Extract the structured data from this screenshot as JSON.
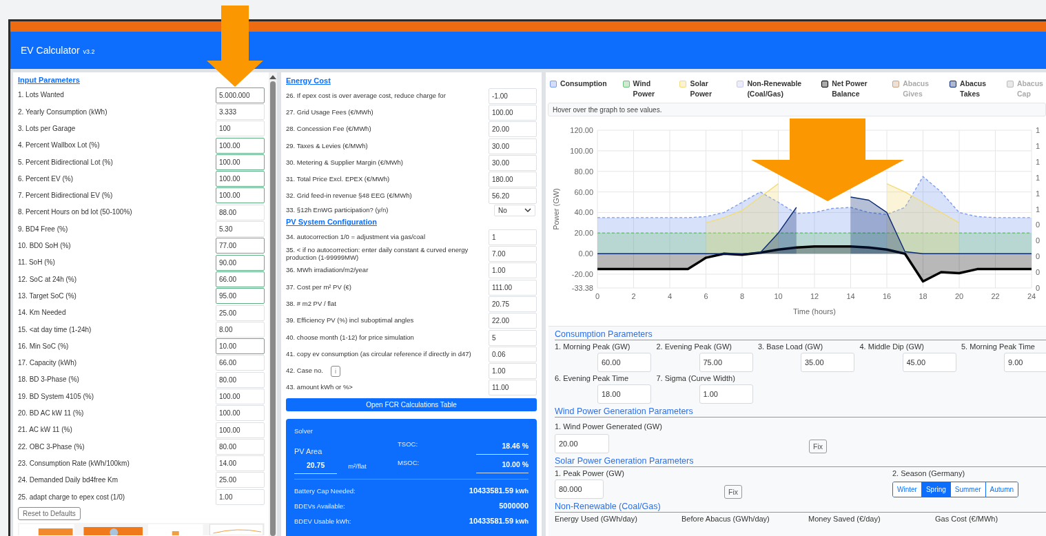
{
  "header": {
    "title": "EV Calculator",
    "version": "v3.2"
  },
  "input_parameters": {
    "title": "Input Parameters",
    "rows": [
      {
        "label": "1. Lots Wanted",
        "value": "5.000.000",
        "highlighted": true
      },
      {
        "label": "2. Yearly Consumption (kWh)",
        "value": "3.333",
        "highlighted": false
      },
      {
        "label": "3. Lots per Garage",
        "value": "100",
        "highlighted": false
      },
      {
        "label": "4. Percent Wallbox Lot (%)",
        "value": "100.00",
        "highlighted": true
      },
      {
        "label": "5. Percent Bidirectional Lot (%)",
        "value": "100.00",
        "highlighted": true
      },
      {
        "label": "6. Percent EV (%)",
        "value": "100.00",
        "highlighted": true
      },
      {
        "label": "7. Percent Bidirectional EV (%)",
        "value": "100.00",
        "highlighted": true
      },
      {
        "label": "8. Percent Hours on bd lot (50-100%)",
        "value": "88.00",
        "highlighted": false
      },
      {
        "label": "9. BD4 Free (%)",
        "value": "5.30",
        "highlighted": false
      },
      {
        "label": "10. BD0 SoH (%)",
        "value": "77.00",
        "highlighted": true
      },
      {
        "label": "11. SoH (%)",
        "value": "90.00",
        "highlighted": true
      },
      {
        "label": "12. SoC at 24h (%)",
        "value": "66.00",
        "highlighted": true
      },
      {
        "label": "13. Target SoC (%)",
        "value": "95.00",
        "highlighted": true
      },
      {
        "label": "14. Km Needed",
        "value": "25.00",
        "highlighted": false
      },
      {
        "label": "15. <at day time (1-24h)",
        "value": "8.00",
        "highlighted": false
      },
      {
        "label": "16. Min SoC (%)",
        "value": "10.00",
        "highlighted": true
      },
      {
        "label": "17. Capacity (kWh)",
        "value": "66.00",
        "highlighted": false
      },
      {
        "label": "18. BD 3-Phase (%)",
        "value": "80.00",
        "highlighted": false
      },
      {
        "label": "19. BD System 4105 (%)",
        "value": "100.00",
        "highlighted": false
      },
      {
        "label": "20. BD AC kW 11 (%)",
        "value": "100.00",
        "highlighted": false
      },
      {
        "label": "21. AC kW 11 (%)",
        "value": "100.00",
        "highlighted": false
      },
      {
        "label": "22. OBC 3-Phase (%)",
        "value": "80.00",
        "highlighted": false
      },
      {
        "label": "23. Consumption Rate (kWh/100km)",
        "value": "14.00",
        "highlighted": false
      },
      {
        "label": "24. Demanded Daily bd4free Km",
        "value": "25.00",
        "highlighted": false
      },
      {
        "label": "25. adapt charge to epex cost (1/0)",
        "value": "1.00",
        "highlighted": false
      }
    ],
    "reset_button": "Reset to Defaults"
  },
  "energy_cost": {
    "title": "Energy Cost",
    "rows": [
      {
        "kind": "input",
        "label": "26. If epex cost is over average cost, reduce charge for",
        "value": "-1.00"
      },
      {
        "kind": "input",
        "label": "27. Grid Usage Fees (€/MWh)",
        "value": "100.00"
      },
      {
        "kind": "input",
        "label": "28. Concession Fee (€/MWh)",
        "value": "20.00"
      },
      {
        "kind": "input",
        "label": "29. Taxes & Levies (€/MWh)",
        "value": "30.00"
      },
      {
        "kind": "input",
        "label": "30. Metering & Supplier Margin (€/MWh)",
        "value": "30.00"
      },
      {
        "kind": "input",
        "label": "31. Total Price Excl. EPEX (€/MWh)",
        "value": "180.00"
      },
      {
        "kind": "input",
        "label": "32. Grid feed-in revenue §48 EEG (€/MWh)",
        "value": "56.20"
      },
      {
        "kind": "select",
        "label": "33. §12h EnWG participation? (y/n)",
        "value": "No"
      }
    ]
  },
  "pv_system": {
    "title": "PV System Configuration",
    "rows": [
      {
        "kind": "input",
        "label": "34. autocorrection 1/0 = adjustment via gas/coal",
        "value": "1"
      },
      {
        "kind": "input",
        "label": "35. < if no autocorrection: enter daily constant & curved energy production (1-99999MW)",
        "value": "7.00"
      },
      {
        "kind": "input",
        "label": "36. MWh irradiation/m2/year",
        "value": "1.00"
      },
      {
        "kind": "input",
        "label": "37. Cost per m² PV (€)",
        "value": "111.00"
      },
      {
        "kind": "input",
        "label": "38. # m2 PV / flat",
        "value": "20.75"
      },
      {
        "kind": "input",
        "label": "39. Efficiency PV (%) incl suboptimal angles",
        "value": "22.00"
      },
      {
        "kind": "input",
        "label": "40. choose month (1-12) for price simulation",
        "value": "5"
      },
      {
        "kind": "input",
        "label": "41. copy ev consumption (as circular reference if directly in d47)",
        "value": "0.06"
      },
      {
        "kind": "input",
        "label": "42. Case no.",
        "value": "1.00",
        "info_button": "i"
      },
      {
        "kind": "input",
        "label": "43. amount kWh or %>",
        "value": "11.00"
      }
    ],
    "fcr_button": "Open FCR Calculations Table"
  },
  "solver": {
    "title": "Solver",
    "pv_label": "PV Area",
    "pv_value": "20.75",
    "pv_unit": "m²/flat",
    "tsoc_label": "TSOC:",
    "tsoc_value": "18.46 %",
    "msoc_label": "MSOC:",
    "msoc_value": "10.00 %",
    "results": [
      {
        "label": "Battery Cap Needed:",
        "value": "10433581.59",
        "unit": "kWh"
      },
      {
        "label": "BDEVs Available:",
        "value": "5000000"
      },
      {
        "label": "BDEV Usable kWh:",
        "value": "10433581.59",
        "unit": "kWh"
      }
    ]
  },
  "legend": [
    {
      "hidden": false
    },
    {
      "hidden": false
    },
    {
      "hidden": false
    },
    {
      "hidden": false
    },
    {
      "hidden": false
    },
    {
      "hidden": true
    },
    {
      "hidden": false
    },
    {
      "hidden": true
    }
  ],
  "hover_hint": "Hover over the graph to see values.",
  "chart": {
    "right_axis_labels": [
      "1",
      "1",
      "1",
      "1",
      "1",
      "1",
      "0",
      "0",
      "0",
      "0",
      "0"
    ],
    "chart_data": {
      "type": "area",
      "grid": true,
      "xlabel": "Time (hours)",
      "ylabel": "Power (GW)",
      "x": [
        0,
        1,
        2,
        3,
        4,
        5,
        6,
        7,
        8,
        9,
        10,
        11,
        12,
        13,
        14,
        15,
        16,
        17,
        18,
        19,
        20,
        21,
        22,
        23,
        24
      ],
      "xlim": [
        0,
        24
      ],
      "ylim": [
        -33.38,
        120
      ],
      "xticks": [
        0,
        2,
        4,
        6,
        8,
        10,
        12,
        14,
        16,
        18,
        20,
        22,
        24
      ],
      "yticks": [
        {
          "value": -33.38,
          "label": "-33.38"
        },
        {
          "value": -20,
          "label": "-20.00"
        },
        {
          "value": 0,
          "label": "0.00"
        },
        {
          "value": 20,
          "label": "20.00"
        },
        {
          "value": 40,
          "label": "40.00"
        },
        {
          "value": 60,
          "label": "60.00"
        },
        {
          "value": 80,
          "label": "80.00"
        },
        {
          "value": 100,
          "label": "100.00"
        },
        {
          "value": 120,
          "label": "120.00"
        }
      ],
      "series": [
        {
          "name": "Consumption",
          "line_style": "dashed",
          "color": "#7d9cf0",
          "values": [
            35,
            35,
            35,
            35,
            35,
            35,
            36,
            40,
            50,
            60,
            50,
            39,
            40,
            44,
            45,
            40,
            38,
            45,
            75,
            60,
            40,
            36,
            35,
            35,
            35
          ]
        },
        {
          "name": "Wind Power",
          "line_style": "dashed",
          "color": "#6cbf7a",
          "values": [
            20,
            20,
            20,
            20,
            20,
            20,
            20,
            20,
            20,
            20,
            20,
            20,
            20,
            20,
            20,
            20,
            20,
            20,
            20,
            20,
            20,
            20,
            20,
            20,
            20
          ]
        },
        {
          "name": "Solar Power",
          "line_style": "solid",
          "color": "#f2dc7a",
          "values": [
            null,
            null,
            null,
            null,
            null,
            null,
            30,
            35,
            42,
            55,
            68,
            null,
            null,
            null,
            null,
            null,
            68,
            60,
            50,
            40,
            30,
            null,
            null,
            null,
            null
          ]
        },
        {
          "name": "Non-Renewable (Coal/Gas)",
          "color": "#c9c9ef",
          "values": [
            null,
            null,
            null,
            null,
            null,
            null,
            null,
            null,
            null,
            null,
            null,
            null,
            null,
            null,
            null,
            null,
            null,
            null,
            null,
            null,
            null,
            null,
            null,
            null,
            null
          ]
        },
        {
          "name": "Net Power Balance",
          "line_style": "solid",
          "color": "#000000",
          "values": [
            -15,
            -15,
            -15,
            -15,
            -15,
            -15,
            -4,
            0,
            -1,
            1,
            4,
            6,
            7,
            7,
            7,
            6,
            4,
            0,
            -27,
            -18,
            -19,
            -15,
            -15,
            -15,
            -15
          ]
        },
        {
          "name": "Abacus Gives",
          "color": "#c9a386",
          "values": [
            null,
            null,
            null,
            null,
            null,
            null,
            null,
            null,
            null,
            null,
            null,
            null,
            null,
            null,
            null,
            null,
            null,
            null,
            null,
            null,
            null,
            null,
            null,
            null,
            null
          ]
        },
        {
          "name": "Abacus Takes",
          "line_style": "solid",
          "color": "#0b2a73",
          "values": [
            0,
            0,
            0,
            0,
            0,
            0,
            0,
            0,
            0,
            1,
            20,
            45,
            null,
            null,
            55,
            52,
            40,
            2,
            0,
            0,
            0,
            0,
            0,
            0,
            0
          ]
        },
        {
          "name": "Abacus Cap",
          "color": "#bbbbbb",
          "values": [
            null,
            null,
            null,
            null,
            null,
            null,
            null,
            null,
            null,
            null,
            null,
            null,
            null,
            null,
            null,
            null,
            null,
            null,
            null,
            null,
            null,
            null,
            null,
            null,
            null
          ]
        }
      ]
    }
  },
  "consumption_parameters": {
    "title": "Consumption Parameters",
    "fields": [
      {
        "label": "1. Morning Peak (GW)",
        "value": "60.00"
      },
      {
        "label": "2. Evening Peak (GW)",
        "value": "75.00"
      },
      {
        "label": "3. Base Load (GW)",
        "value": "35.00"
      },
      {
        "label": "4. Middle Dip (GW)",
        "value": "45.00"
      },
      {
        "label": "5. Morning Peak Time",
        "value": "9.00"
      },
      {
        "label": "6. Evening Peak Time",
        "value": "18.00"
      },
      {
        "label": "7. Sigma (Curve Width)",
        "value": "1.00"
      }
    ]
  },
  "wind_parameters": {
    "title": "Wind Power Generation Parameters",
    "label": "1. Wind Power Generated (GW)",
    "value": "20.00",
    "button": "Fix"
  },
  "solar_parameters": {
    "title": "Solar Power Generation Parameters",
    "label": "1. Peak Power (GW)",
    "value": "80.000",
    "button": "Fix",
    "season_label": "2. Season (Germany)",
    "seasons": [
      {
        "label": "Winter",
        "selected": false
      },
      {
        "label": "Spring",
        "selected": true
      },
      {
        "label": "Summer",
        "selected": false
      },
      {
        "label": "Autumn",
        "selected": false
      }
    ]
  },
  "non_renewable": {
    "title": "Non-Renewable (Coal/Gas)",
    "columns": [
      "Energy Used (GWh/day)",
      "Before Abacus (GWh/day)",
      "Money Saved (€/day)",
      "Gas Cost (€/MWh)"
    ]
  }
}
